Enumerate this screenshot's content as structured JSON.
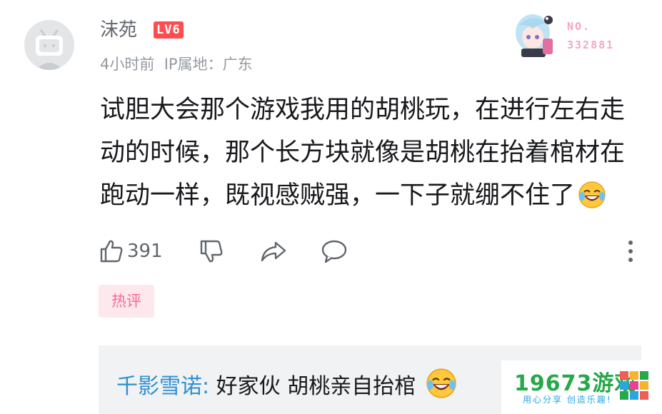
{
  "comment": {
    "username": "沫苑",
    "level": "LV6",
    "time": "4小时前",
    "ip_label": "IP属地：广东",
    "text": "试胆大会那个游戏我用的胡桃玩，在进行左右走动的时候，那个长方块就像是胡桃在抬着棺材在跑动一样，既视感贼强，一下子就绷不住了",
    "fan_badge": {
      "no_label": "NO.",
      "number": "332881"
    },
    "likes": "391",
    "hot_tag": "热评"
  },
  "reply": {
    "name": "千影雪诺",
    "separator": ":",
    "text": "好家伙  胡桃亲自抬棺"
  },
  "watermark": {
    "title": "19673游戏",
    "subtitle": "用心分享 创造乐趣!"
  },
  "icons": [
    "tv-avatar-icon",
    "thumbs-up-icon",
    "thumbs-down-icon",
    "share-icon",
    "reply-icon",
    "more-icon",
    "laugh-emoji-icon",
    "cube-logo-icon"
  ],
  "colors": {
    "accent_pink": "#ff6699",
    "level_red": "#ff4d4f",
    "reply_name_blue": "#2f8fd1",
    "watermark_green": "#27a84a"
  }
}
